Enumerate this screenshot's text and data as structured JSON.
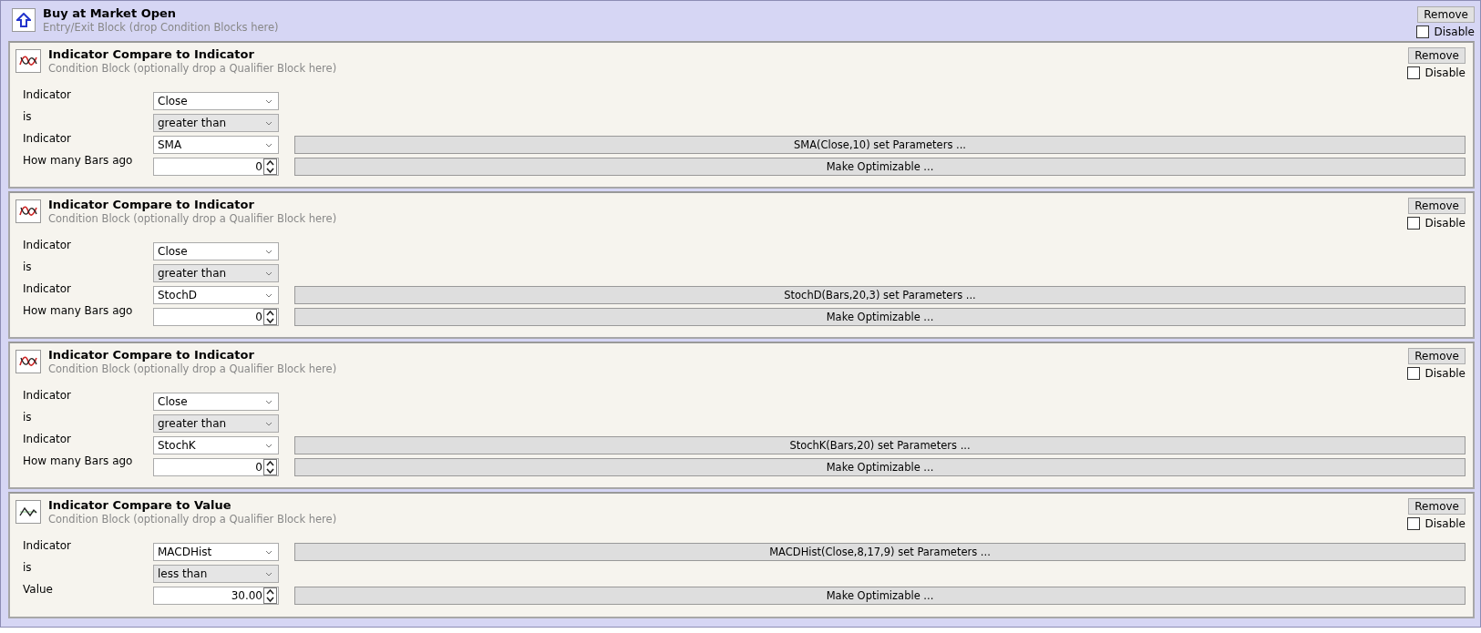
{
  "entry_block": {
    "title": "Buy at Market Open",
    "subtitle": "Entry/Exit Block (drop Condition Blocks here)",
    "remove_label": "Remove",
    "disable_label": "Disable",
    "disabled": false
  },
  "conditions": [
    {
      "kind": "indicator",
      "title": "Indicator Compare to Indicator",
      "subtitle": "Condition Block (optionally drop a Qualifier Block here)",
      "remove_label": "Remove",
      "disable_label": "Disable",
      "disabled": false,
      "rows": [
        {
          "label": "Indicator",
          "kind": "combo",
          "value": "Close"
        },
        {
          "label": "is",
          "kind": "dropdown",
          "value": "greater than"
        },
        {
          "label": "Indicator",
          "kind": "combo",
          "value": "SMA",
          "button": "SMA(Close,10) set Parameters ..."
        },
        {
          "label": "How many Bars ago",
          "kind": "spinner",
          "value": "0",
          "button": "Make Optimizable ..."
        }
      ]
    },
    {
      "kind": "indicator",
      "title": "Indicator Compare to Indicator",
      "subtitle": "Condition Block (optionally drop a Qualifier Block here)",
      "remove_label": "Remove",
      "disable_label": "Disable",
      "disabled": false,
      "rows": [
        {
          "label": "Indicator",
          "kind": "combo",
          "value": "Close"
        },
        {
          "label": "is",
          "kind": "dropdown",
          "value": "greater than"
        },
        {
          "label": "Indicator",
          "kind": "combo",
          "value": "StochD",
          "button": "StochD(Bars,20,3) set Parameters ..."
        },
        {
          "label": "How many Bars ago",
          "kind": "spinner",
          "value": "0",
          "button": "Make Optimizable ..."
        }
      ]
    },
    {
      "kind": "indicator",
      "title": "Indicator Compare to Indicator",
      "subtitle": "Condition Block (optionally drop a Qualifier Block here)",
      "remove_label": "Remove",
      "disable_label": "Disable",
      "disabled": false,
      "rows": [
        {
          "label": "Indicator",
          "kind": "combo",
          "value": "Close"
        },
        {
          "label": "is",
          "kind": "dropdown",
          "value": "greater than"
        },
        {
          "label": "Indicator",
          "kind": "combo",
          "value": "StochK",
          "button": "StochK(Bars,20) set Parameters ..."
        },
        {
          "label": "How many Bars ago",
          "kind": "spinner",
          "value": "0",
          "button": "Make Optimizable ..."
        }
      ]
    },
    {
      "kind": "value",
      "title": "Indicator Compare to Value",
      "subtitle": "Condition Block (optionally drop a Qualifier Block here)",
      "remove_label": "Remove",
      "disable_label": "Disable",
      "disabled": false,
      "rows": [
        {
          "label": "Indicator",
          "kind": "combo",
          "value": "MACDHist",
          "button": "MACDHist(Close,8,17,9) set Parameters ..."
        },
        {
          "label": "is",
          "kind": "dropdown",
          "value": "less than"
        },
        {
          "label": "Value",
          "kind": "spinner",
          "value": "30.00",
          "button": "Make Optimizable ..."
        }
      ]
    }
  ]
}
